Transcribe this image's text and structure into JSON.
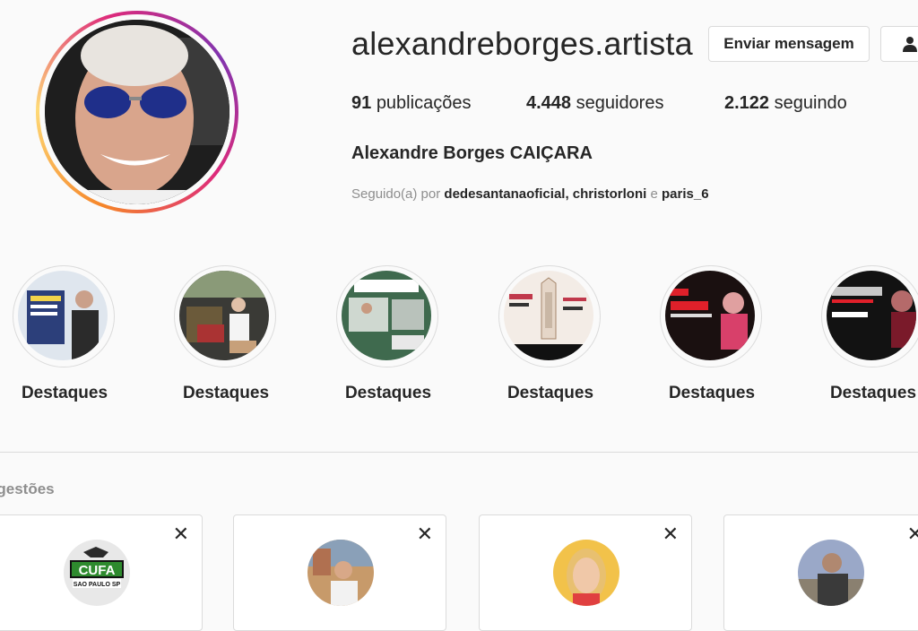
{
  "profile": {
    "username": "alexandreborges.artista",
    "message_button": "Enviar mensagem",
    "stats": {
      "posts_count": "91",
      "posts_label": "publicações",
      "followers_count": "4.448",
      "followers_label": "seguidores",
      "following_count": "2.122",
      "following_label": "seguindo"
    },
    "full_name": "Alexandre Borges CAIÇARA",
    "followed_by_prefix": "Seguido(a) por",
    "followed_by_users": [
      "dedesantanaoficial",
      "christorloni",
      "paris_6"
    ],
    "followed_by_sep": ", ",
    "followed_by_and": " e "
  },
  "highlights": [
    {
      "label": "Destaques"
    },
    {
      "label": "Destaques"
    },
    {
      "label": "Destaques"
    },
    {
      "label": "Destaques"
    },
    {
      "label": "Destaques"
    },
    {
      "label": "Destaques"
    }
  ],
  "suggestions": {
    "title": "ugestões",
    "close_glyph": "✕",
    "cards": [
      {
        "avatar_text": "CUFA",
        "avatar_subtext": "SAO PAULO SP"
      },
      {},
      {},
      {}
    ]
  },
  "colors": {
    "ring_start": "#f58529",
    "ring_mid": "#dd2a7b",
    "ring_end": "#8134af",
    "text_primary": "#262626",
    "text_secondary": "#8e8e8e",
    "border": "#dbdbdb"
  },
  "icons": {
    "follow_button": "person-icon",
    "card_close": "close-icon"
  }
}
